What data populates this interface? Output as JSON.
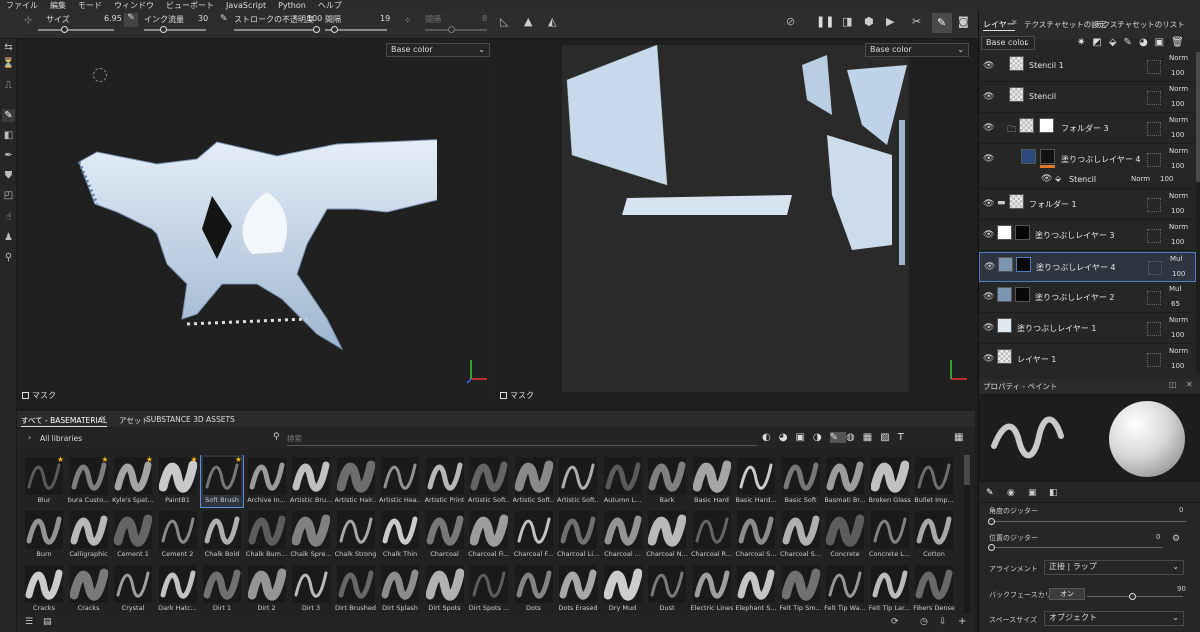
{
  "menu": [
    "ファイル",
    "編集",
    "モード",
    "ウィンドウ",
    "ビューポート",
    "JavaScript",
    "Python",
    "ヘルプ"
  ],
  "toolbar": {
    "size_label": "サイズ",
    "size_value": "6.95",
    "flow_label": "インク流量",
    "flow_value": "30",
    "opacity_label": "ストロークの不透明度",
    "opacity_value": "100",
    "spacing_label": "間隔",
    "spacing_value": "19",
    "jitter_label": "間隔",
    "jitter_value": "8"
  },
  "viewport3d": {
    "channel": "Base color",
    "mask_label": "マスク"
  },
  "viewport2d": {
    "channel": "Base color",
    "mask_label": "マスク"
  },
  "layers_panel": {
    "tabs": [
      "レイヤー",
      "テクスチャセットの設定",
      "テクスチャセットのリスト"
    ],
    "channel": "Base color",
    "layers": [
      {
        "name": "Stencil 1",
        "blend": "Norm",
        "opacity": "100",
        "thumb": "checker"
      },
      {
        "name": "Stencil",
        "blend": "Norm",
        "opacity": "100",
        "thumb": "checker"
      },
      {
        "name": "フォルダー 3",
        "blend": "Norm",
        "opacity": "100",
        "thumb": "checker"
      },
      {
        "name": "塗りつぶしレイヤー 4",
        "blend": "Norm",
        "opacity": "100",
        "thumb": "blue"
      },
      {
        "name": "Stencil",
        "blend": "Norm",
        "opacity": "100",
        "thumb": "none"
      },
      {
        "name": "フォルダー 1",
        "blend": "Norm",
        "opacity": "100",
        "thumb": "checker"
      },
      {
        "name": "塗りつぶしレイヤー 3",
        "blend": "Norm",
        "opacity": "100",
        "thumb": "white"
      },
      {
        "name": "塗りつぶしレイヤー 4",
        "blend": "Mul",
        "opacity": "100",
        "thumb": "bluegray"
      },
      {
        "name": "塗りつぶしレイヤー 2",
        "blend": "Mul",
        "opacity": "65",
        "thumb": "bluegray"
      },
      {
        "name": "塗りつぶしレイヤー 1",
        "blend": "Norm",
        "opacity": "100",
        "thumb": "pale"
      },
      {
        "name": "レイヤー 1",
        "blend": "Norm",
        "opacity": "100",
        "thumb": "checker"
      }
    ]
  },
  "properties": {
    "title": "プロパティ - ペイント",
    "angle_jitter_label": "角度のジッター",
    "angle_jitter_value": "0",
    "position_jitter_label": "位置のジッター",
    "position_jitter_value": "0",
    "alignment_label": "アラインメント",
    "alignment_value": "正接 | ラップ",
    "backface_label": "バックフェースカリング",
    "backface_toggle": "オン",
    "backface_value": "90",
    "space_label": "スペースサイズ",
    "space_value": "オブジェクト"
  },
  "browser": {
    "tabs": [
      "すべて - BASEMATERIAL",
      "アセット",
      "SUBSTANCE 3D ASSETS"
    ],
    "libraries": "All libraries",
    "search_placeholder": "検索",
    "brushes": [
      "Blur",
      "bura Custo...",
      "Kyle's Spat...",
      "PaintB1",
      "Soft Brush",
      "Archive In...",
      "Artistic Bru...",
      "Artistic Hair...",
      "Artistic Hea...",
      "Artistic Print",
      "Artistic Soft...",
      "Artistic Soft...",
      "Artistic Soft...",
      "Autumn L...",
      "Bark",
      "Basic Hard",
      "Basic Hard...",
      "Basic Soft",
      "Basmati Br...",
      "Broken Glass",
      "Bullet Imp...",
      "Burn",
      "Calligraphic",
      "Cement 1",
      "Cement 2",
      "Chalk Bold",
      "Chalk Bum...",
      "Chalk Spre...",
      "Chalk Strong",
      "Chalk Thin",
      "Charcoal",
      "Charcoal Fi...",
      "Charcoal F...",
      "Charcoal Li...",
      "Charcoal ...",
      "Charcoal N...",
      "Charcoal R...",
      "Charcoal S...",
      "Charcoal S...",
      "Concrete",
      "Concrete L...",
      "Cotton",
      "Cracks",
      "Cracks",
      "Crystal",
      "Dark Hatc...",
      "Dirt 1",
      "Dirt 2",
      "Dirt 3",
      "Dirt Brushed",
      "Dirt Splash",
      "Dirt Spots",
      "Dirt Spots ...",
      "Dots",
      "Dots Erased",
      "Dry Mud",
      "Dust",
      "Electric Lines",
      "Elephant S...",
      "Felt Tip Sm...",
      "Felt Tip Wa...",
      "Felt Tip Lar...",
      "Fibers Dense"
    ]
  }
}
